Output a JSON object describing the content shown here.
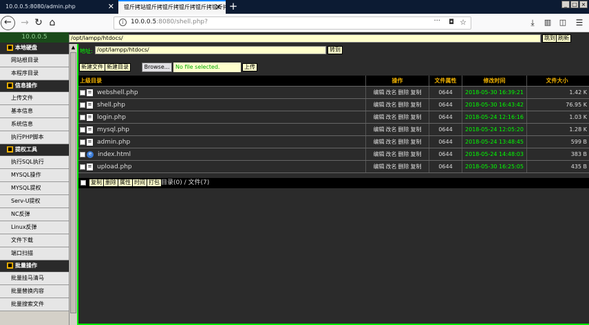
{
  "browser": {
    "tabs": [
      {
        "label": "10.0.0.5:8080/admin.php",
        "active": false
      },
      {
        "label": "锟斤拷站锟斤拷锟斤拷锟斤拷锟斤拷锟斤拷�",
        "active": true
      }
    ],
    "url_host": "10.0.0.5",
    "url_rest": ":8080/shell.php?",
    "close_glyph": "✕",
    "new_tab_glyph": "+"
  },
  "webshell": {
    "server_ip": "10.0.0.5",
    "path_value": "/opt/lampp/htdocs/",
    "jump_label": "跳到",
    "refresh_label": "刷新",
    "addr_label": "地址:",
    "addr_value": "/opt/lampp/htdocs/",
    "goto_label": "转到",
    "new_file_label": "新建文件",
    "new_dir_label": "新建目录",
    "browse_label": "Browse...",
    "file_status": "No file selected.",
    "upload_label": "上传",
    "columns": [
      "上级目录",
      "操作",
      "文件属性",
      "修改时间",
      "文件大小"
    ],
    "ops": [
      "编辑",
      "改名",
      "删除",
      "复制"
    ],
    "files": [
      {
        "name": "webshell.php",
        "perm": "0644",
        "time": "2018-05-30 16:39:21",
        "size": "1.42 K",
        "icon": "doc-icon"
      },
      {
        "name": "shell.php",
        "perm": "0644",
        "time": "2018-05-30 16:43:42",
        "size": "76.95 K",
        "icon": "doc-icon"
      },
      {
        "name": "login.php",
        "perm": "0644",
        "time": "2018-05-24 12:16:16",
        "size": "1.03 K",
        "icon": "doc-icon"
      },
      {
        "name": "mysql.php",
        "perm": "0644",
        "time": "2018-05-24 12:05:20",
        "size": "1.28 K",
        "icon": "doc-icon"
      },
      {
        "name": "admin.php",
        "perm": "0644",
        "time": "2018-05-24 13:48:45",
        "size": "599 B",
        "icon": "doc-icon"
      },
      {
        "name": "index.html",
        "perm": "0644",
        "time": "2018-05-24 14:48:03",
        "size": "383 B",
        "icon": "ie-icon"
      },
      {
        "name": "upload.php",
        "perm": "0644",
        "time": "2018-05-30 16:25:05",
        "size": "435 B",
        "icon": "doc-icon"
      }
    ],
    "bulk_actions": [
      "复制",
      "删除",
      "属性",
      "时间",
      "打包"
    ],
    "summary": "目录(0) / 文件(7)"
  },
  "sidebar": {
    "sections": [
      {
        "title": "本地硬盘",
        "items": [
          "网站根目录",
          "本程序目录"
        ]
      },
      {
        "title": "信息操作",
        "items": [
          "上传文件",
          "基本信息",
          "系统信息",
          "执行PHP脚本"
        ]
      },
      {
        "title": "提权工具",
        "items": [
          "执行SQL执行",
          "MYSQL操作",
          "MYSQL提权",
          "Serv-U提权",
          "NC反弹",
          "Linux反弹",
          "文件下载",
          "端口扫描"
        ]
      },
      {
        "title": "批量操作",
        "items": [
          "批量挂马清马",
          "批量替换内容",
          "批量搜索文件"
        ]
      }
    ]
  }
}
